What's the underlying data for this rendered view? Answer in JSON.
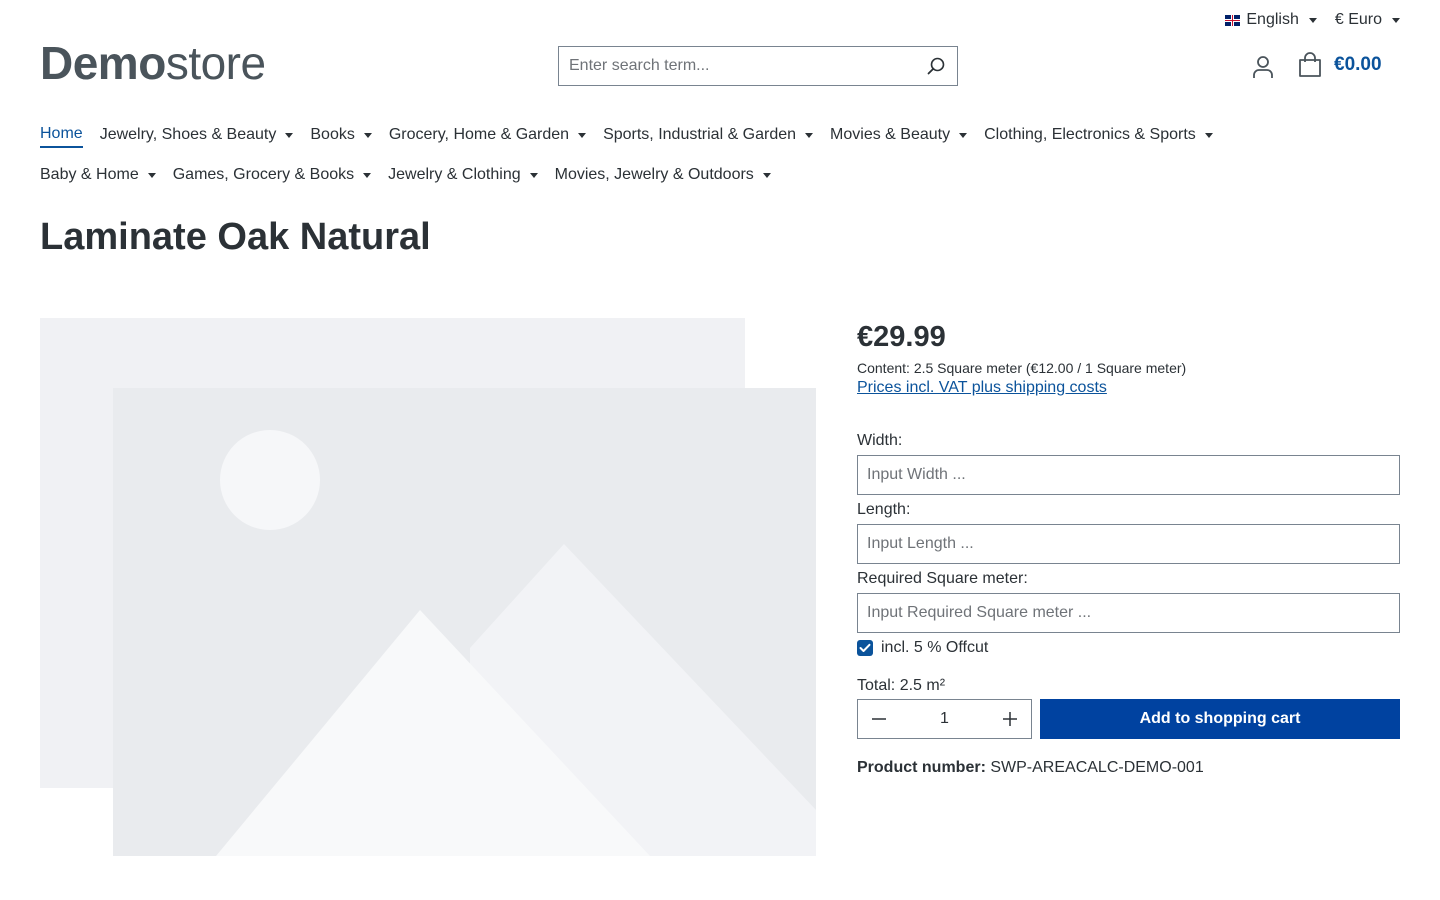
{
  "topbar": {
    "language": "English",
    "currency": "€ Euro"
  },
  "logo": {
    "bold": "Demo",
    "light": "store"
  },
  "search": {
    "placeholder": "Enter search term..."
  },
  "cart": {
    "total": "€0.00"
  },
  "nav": {
    "row1": [
      {
        "label": "Home",
        "active": true,
        "dropdown": false
      },
      {
        "label": "Jewelry, Shoes & Beauty",
        "dropdown": true
      },
      {
        "label": "Books",
        "dropdown": true
      },
      {
        "label": "Grocery, Home & Garden",
        "dropdown": true
      },
      {
        "label": "Sports, Industrial & Garden",
        "dropdown": true
      },
      {
        "label": "Movies & Beauty",
        "dropdown": true
      },
      {
        "label": "Clothing, Electronics & Sports",
        "dropdown": true
      }
    ],
    "row2": [
      {
        "label": "Baby & Home",
        "dropdown": true
      },
      {
        "label": "Games, Grocery & Books",
        "dropdown": true
      },
      {
        "label": "Jewelry & Clothing",
        "dropdown": true
      },
      {
        "label": "Movies, Jewelry & Outdoors",
        "dropdown": true
      }
    ]
  },
  "product": {
    "title": "Laminate Oak Natural",
    "price": "€29.99",
    "content": "Content: 2.5 Square meter (€12.00 / 1 Square meter)",
    "vat_link": "Prices incl. VAT plus shipping costs",
    "width_label": "Width:",
    "width_placeholder": "Input Width ...",
    "length_label": "Length:",
    "length_placeholder": "Input Length ...",
    "sqm_label": "Required Square meter:",
    "sqm_placeholder": "Input Required Square meter ...",
    "offcut_label": "incl. 5 % Offcut",
    "offcut_checked": true,
    "total": "Total: 2.5 m²",
    "quantity": "1",
    "add_to_cart": "Add to shopping cart",
    "product_number_label": "Product number:",
    "product_number": "SWP-AREACALC-DEMO-001"
  },
  "colors": {
    "accent": "#0b539b",
    "button": "#0042a0",
    "placeholder_bg": "#e9ebee",
    "placeholder_light": "#f3f4f6"
  }
}
